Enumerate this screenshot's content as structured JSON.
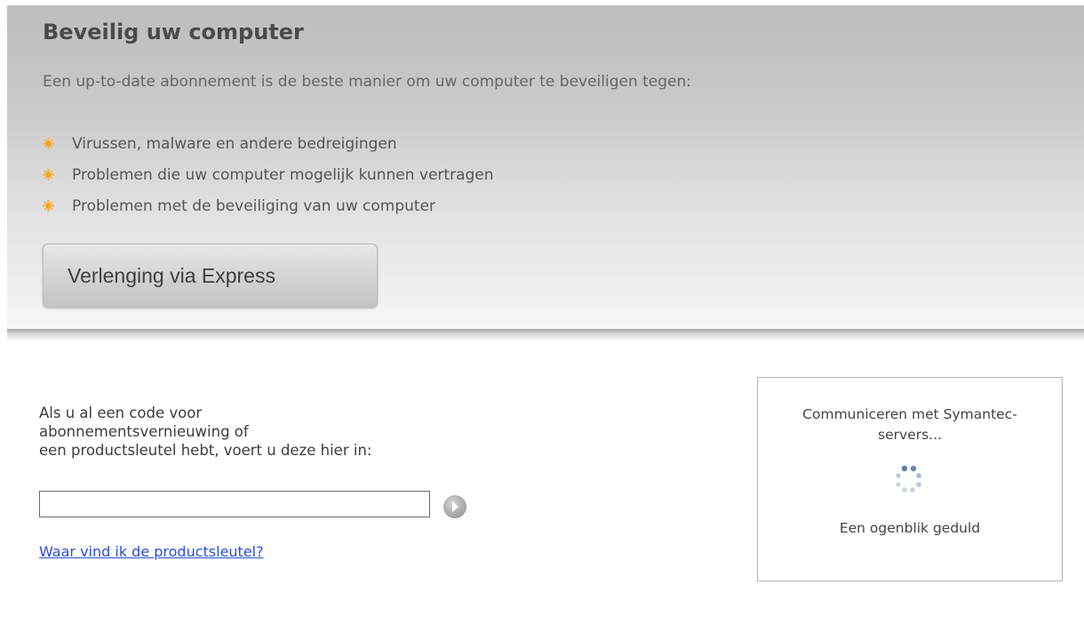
{
  "hero": {
    "title": "Beveilig uw computer",
    "intro": "Een up-to-date abonnement is de beste manier om uw computer te beveiligen tegen:",
    "bullets": [
      "Virussen, malware en andere bedreigingen",
      "Problemen die uw computer mogelijk kunnen vertragen",
      "Problemen met de beveiliging van uw computer"
    ],
    "button_label": "Verlenging via Express"
  },
  "key_entry": {
    "prompt_lines": [
      "Als u al een code voor",
      "abonnementsvernieuwing of",
      "een productsleutel hebt, voert u deze hier in:"
    ],
    "input_value": "",
    "help_link": "Waar vind ik de productsleutel?"
  },
  "status": {
    "message": "Communiceren met Symantec-servers...",
    "wait": "Een ogenblik geduld"
  },
  "icons": {
    "bullet": "orange-sun-bullet-icon",
    "submit": "arrow-right-circle-icon",
    "spinner": "loading-spinner-icon"
  },
  "colors": {
    "bullet": "#f5a623",
    "link": "#2a4fd6",
    "spinner": "#8da8c8"
  }
}
